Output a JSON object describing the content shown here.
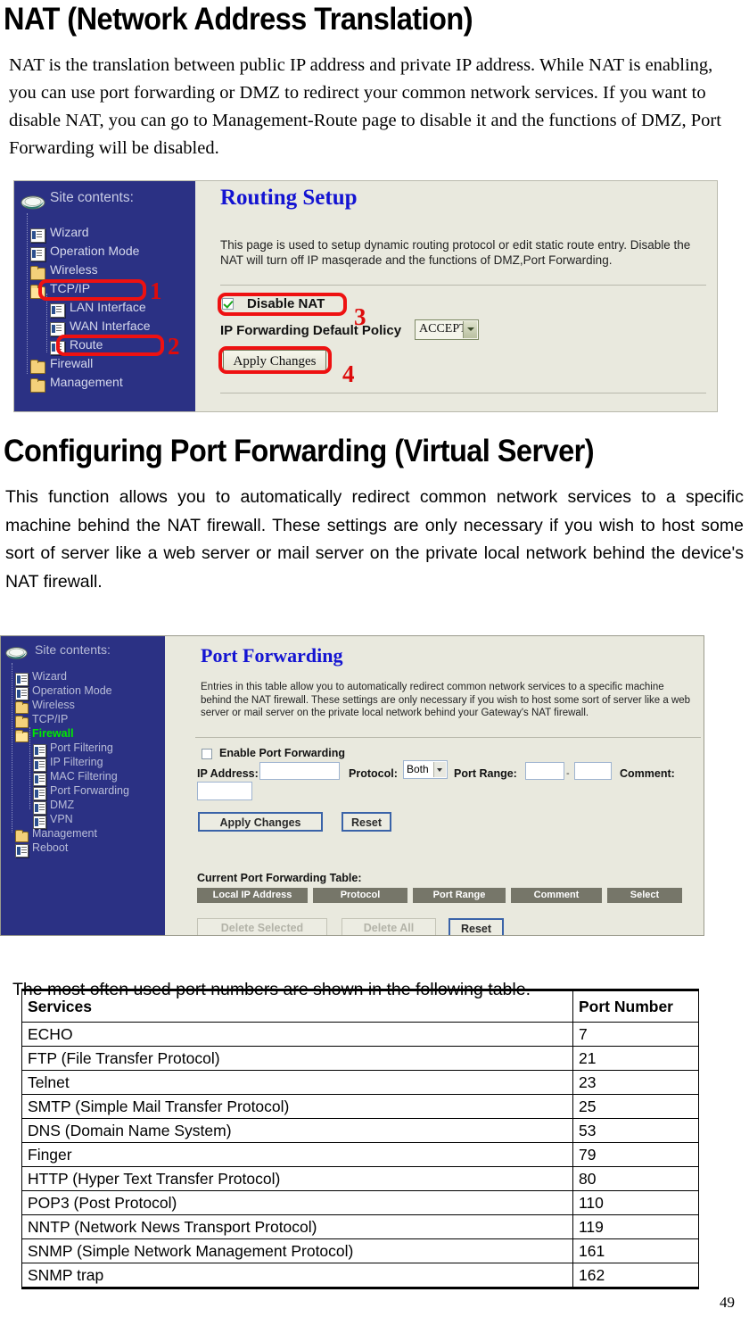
{
  "document": {
    "page_number": "49",
    "heading_nat": "NAT (Network Address Translation)",
    "paragraph_nat": "NAT is the translation between public IP address and private IP address. While NAT is enabling, you can use port forwarding or DMZ to redirect your common network services. If you want to disable NAT, you can go to Management-Route page to disable it and the functions of DMZ, Port Forwarding will be disabled.",
    "heading_port_forwarding": "Configuring Port Forwarding (Virtual Server)",
    "paragraph_port_forwarding": "This function allows you to automatically redirect common network services to a specific machine behind the NAT firewall. These settings are only necessary if you wish to host some sort of server like a web server or mail server on the private local network behind the device's NAT firewall.",
    "paragraph_ports_intro": "The most often used port numbers are shown in the following table."
  },
  "routing_screenshot": {
    "sidebar": {
      "header": "Site contents:",
      "items": [
        {
          "label": "Wizard",
          "icon": "page-icon",
          "indent": 0
        },
        {
          "label": "Operation Mode",
          "icon": "page-icon",
          "indent": 0
        },
        {
          "label": "Wireless",
          "icon": "folder-icon",
          "indent": 0
        },
        {
          "label": "TCP/IP",
          "icon": "folder-open-icon",
          "indent": 0
        },
        {
          "label": "LAN Interface",
          "icon": "page-icon",
          "indent": 1
        },
        {
          "label": "WAN Interface",
          "icon": "page-icon",
          "indent": 1
        },
        {
          "label": "Route",
          "icon": "page-icon",
          "indent": 1
        },
        {
          "label": "Firewall",
          "icon": "folder-icon",
          "indent": 0
        },
        {
          "label": "Management",
          "icon": "folder-icon",
          "indent": 0
        }
      ]
    },
    "panel": {
      "title": "Routing Setup",
      "description": "This page is used to setup dynamic routing protocol or edit static route entry. Disable the NAT will turn off IP masqerade and the functions of DMZ,Port Forwarding.",
      "disable_nat_label": "Disable NAT",
      "disable_nat_checked": true,
      "ip_forwarding_policy_label": "IP Forwarding Default Policy",
      "ip_forwarding_policy_value": "ACCEPT",
      "apply_changes_label": "Apply Changes"
    },
    "annotations": [
      {
        "number": "1",
        "target": "sidebar-item-tcpip"
      },
      {
        "number": "2",
        "target": "sidebar-item-route"
      },
      {
        "number": "3",
        "target": "disable-nat-checkbox"
      },
      {
        "number": "4",
        "target": "apply-changes-button"
      }
    ],
    "colors": {
      "sidebar_bg": "#2b3184",
      "panel_bg": "#e9e9de",
      "title_blue": "#1414d2",
      "annotation_red": "#ee1111"
    }
  },
  "port_forwarding_screenshot": {
    "sidebar": {
      "header": "Site contents:",
      "items": [
        {
          "label": "Wizard",
          "icon": "page-icon",
          "indent": 0,
          "active": false
        },
        {
          "label": "Operation Mode",
          "icon": "page-icon",
          "indent": 0,
          "active": false
        },
        {
          "label": "Wireless",
          "icon": "folder-icon",
          "indent": 0,
          "active": false
        },
        {
          "label": "TCP/IP",
          "icon": "folder-icon",
          "indent": 0,
          "active": false
        },
        {
          "label": "Firewall",
          "icon": "folder-open-icon",
          "indent": 0,
          "active": true
        },
        {
          "label": "Port Filtering",
          "icon": "page-icon",
          "indent": 1,
          "active": false
        },
        {
          "label": "IP Filtering",
          "icon": "page-icon",
          "indent": 1,
          "active": false
        },
        {
          "label": "MAC Filtering",
          "icon": "page-icon",
          "indent": 1,
          "active": false
        },
        {
          "label": "Port Forwarding",
          "icon": "page-icon",
          "indent": 1,
          "active": false
        },
        {
          "label": "DMZ",
          "icon": "page-icon",
          "indent": 1,
          "active": false
        },
        {
          "label": "VPN",
          "icon": "page-icon",
          "indent": 1,
          "active": false
        },
        {
          "label": "Management",
          "icon": "folder-icon",
          "indent": 0,
          "active": false
        },
        {
          "label": "Reboot",
          "icon": "page-icon",
          "indent": 0,
          "active": false
        }
      ]
    },
    "panel": {
      "title": "Port Forwarding",
      "description": "Entries in this table allow you to automatically redirect common network services to a specific machine behind the NAT firewall. These settings are only necessary if you wish to host some sort of server like a web server or mail server on the private local network behind your Gateway's NAT firewall.",
      "enable_label": "Enable Port Forwarding",
      "enable_checked": false,
      "ip_address_label": "IP Address:",
      "ip_address_value": "",
      "protocol_label": "Protocol:",
      "protocol_value": "Both",
      "port_range_label": "Port Range:",
      "port_range_from": "",
      "port_range_sep": "-",
      "port_range_to": "",
      "comment_label": "Comment:",
      "comment_value": "",
      "apply_changes_label": "Apply Changes",
      "reset_label": "Reset",
      "table_caption": "Current Port Forwarding Table:",
      "table_headers": [
        "Local IP Address",
        "Protocol",
        "Port Range",
        "Comment",
        "Select"
      ],
      "delete_selected_label": "Delete Selected",
      "delete_all_label": "Delete All",
      "bottom_reset_label": "Reset"
    },
    "colors": {
      "sidebar_bg": "#2b3184",
      "panel_bg": "#e9e9de",
      "title_blue": "#1414d2",
      "table_header_bg": "#767669",
      "active_item_green": "#00e900"
    }
  },
  "ports_table": {
    "headers": [
      "Services",
      "Port Number"
    ],
    "rows": [
      {
        "service": "ECHO",
        "port": "7"
      },
      {
        "service": "FTP (File Transfer Protocol)",
        "port": "21"
      },
      {
        "service": "Telnet",
        "port": "23"
      },
      {
        "service": "SMTP (Simple Mail Transfer Protocol)",
        "port": "25"
      },
      {
        "service": "DNS (Domain Name System)",
        "port": "53"
      },
      {
        "service": "Finger",
        "port": "79"
      },
      {
        "service": "HTTP (Hyper Text Transfer Protocol)",
        "port": "80"
      },
      {
        "service": "POP3 (Post Protocol)",
        "port": "110"
      },
      {
        "service": "NNTP (Network News Transport Protocol)",
        "port": "119"
      },
      {
        "service": "SNMP (Simple Network Management Protocol)",
        "port": "161"
      },
      {
        "service": "SNMP trap",
        "port": "162"
      }
    ]
  }
}
